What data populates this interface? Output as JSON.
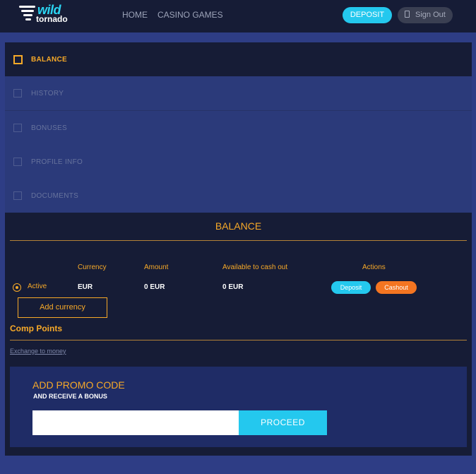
{
  "header": {
    "logo": {
      "wild": "wild",
      "tornado": "tornado"
    },
    "nav": {
      "home": "HOME",
      "casino_games": "CASINO GAMES"
    },
    "deposit_label": "DEPOSIT",
    "signout_label": "Sign Out",
    "colors": {
      "accent": "#24c8ee",
      "header_bg": "#161c36"
    }
  },
  "menu": {
    "items": [
      {
        "label": "BALANCE",
        "active": true
      },
      {
        "label": "HISTORY",
        "active": false
      },
      {
        "label": "BONUSES",
        "active": false
      },
      {
        "label": "PROFILE INFO",
        "active": false
      },
      {
        "label": "DOCUMENTS",
        "active": false
      }
    ]
  },
  "balance": {
    "title": "BALANCE",
    "columns": [
      "Currency",
      "Amount",
      "Available to cash out",
      "Actions"
    ],
    "rows": [
      {
        "status": "Active",
        "currency": "EUR",
        "amount": "0 EUR",
        "available": "0 EUR",
        "deposit_label": "Deposit",
        "cashout_label": "Cashout"
      }
    ],
    "add_currency_label": "Add currency"
  },
  "comp_points": {
    "title": "Comp Points",
    "exchange_link": "Exchange to money"
  },
  "promo": {
    "title": "ADD PROMO CODE",
    "subtitle": "AND RECEIVE A BONUS",
    "input_value": "",
    "proceed_label": "PROCEED"
  },
  "colors": {
    "orange": "#f7a928",
    "cashout": "#f47521",
    "page_bg": "#2e3d85"
  }
}
